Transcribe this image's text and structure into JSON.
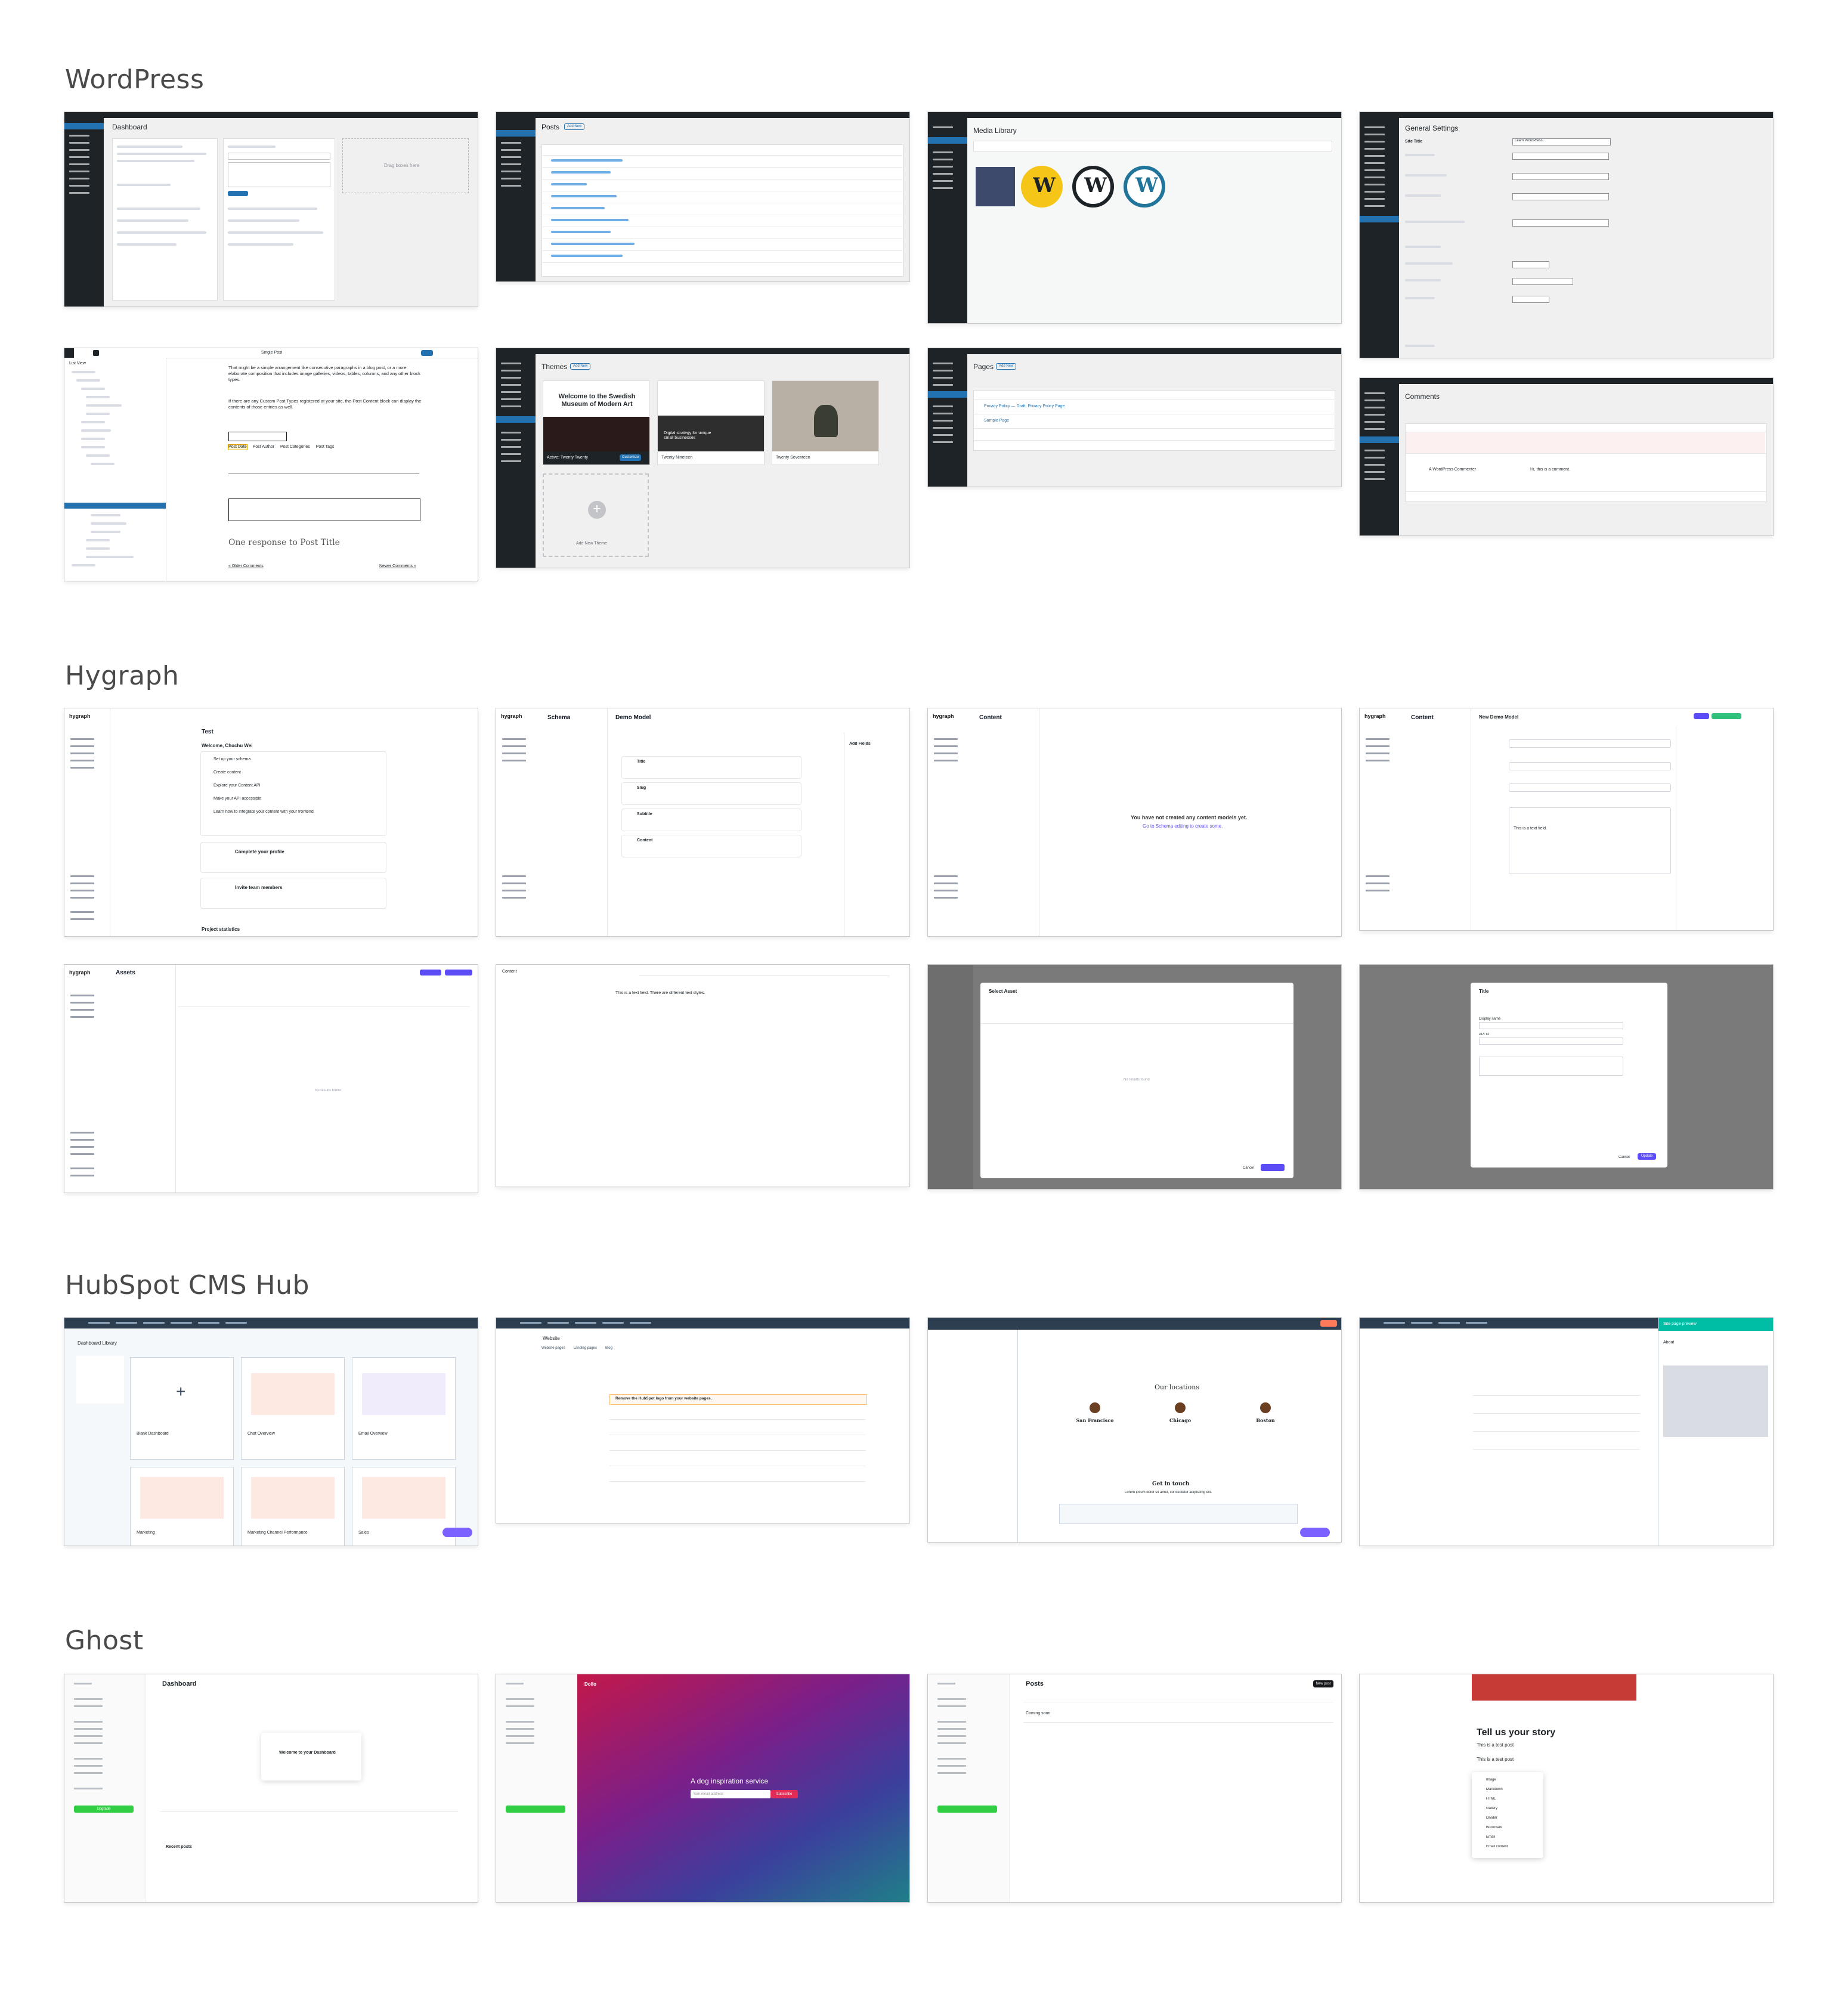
{
  "sections": {
    "wordpress": "WordPress",
    "hygraph": "Hygraph",
    "hubspot": "HubSpot CMS Hub",
    "ghost": "Ghost"
  },
  "wordpress": {
    "dashboard": {
      "title": "Dashboard",
      "drag_box": "Drag boxes here"
    },
    "posts": {
      "title": "Posts",
      "add_new": "Add New"
    },
    "media": {
      "title": "Media Library",
      "add_new": "Add New"
    },
    "settings": {
      "title": "General Settings",
      "site_title_label": "Site Title",
      "site_title_value": "Learn WordPress"
    },
    "editor": {
      "template": "Single Post",
      "list_view": "List View",
      "paragraph_1": "That might be a simple arrangement like consecutive paragraphs in a blog post, or a more elaborate composition that includes image galleries, videos, tables, columns, and any other block types.",
      "paragraph_2": "If there are any Custom Post Types registered at your site, the Post Content block can display the contents of those entries as well.",
      "meta_items": [
        "Post Date",
        "Post Author",
        "Post Categories",
        "Post Tags"
      ],
      "response_heading": "One response to Post Title",
      "older_comments": "« Older Comments",
      "newer_comments": "Newer Comments »",
      "selected_block": "Post Date"
    },
    "themes": {
      "title": "Themes",
      "add_new": "Add New",
      "museum_heading": "Welcome to the Swedish Museum of Modern Art",
      "active_label": "Active: Twenty Twenty",
      "customize": "Customize",
      "theme_2": "Twenty Nineteen",
      "theme_2_text": "Digital strategy for unique small businesses",
      "theme_3": "Twenty Seventeen",
      "add_theme": "Add New Theme"
    },
    "pages": {
      "title": "Pages",
      "add_new": "Add New",
      "rows": [
        "Privacy Policy — Draft, Privacy Policy Page",
        "Sample Page"
      ]
    },
    "comments": {
      "title": "Comments",
      "author": "A WordPress Commenter",
      "text": "Hi, this is a comment."
    }
  },
  "hygraph": {
    "logo": "hygraph",
    "getting_started": {
      "title": "Test",
      "welcome": "Welcome, Chuchu Wei",
      "steps": [
        "Set up your schema",
        "Create content",
        "Explore your Content API",
        "Make your API accessible",
        "Learn how to integrate your content with your frontend"
      ],
      "profile": "Complete your profile",
      "invite": "Invite team members",
      "stats": "Project statistics"
    },
    "schema": {
      "title": "Schema",
      "model": "Demo Model",
      "add_fields": "Add Fields",
      "fields": [
        "Title",
        "Slug",
        "Subtitle",
        "Content"
      ]
    },
    "content_empty": {
      "title": "Content",
      "empty": "You have not created any content models yet.",
      "link": "Go to Schema editing to create some."
    },
    "content_editor": {
      "title": "Content",
      "entry": "New Demo Model",
      "body": "This is a text field."
    },
    "assets": {
      "title": "Assets",
      "empty": "No results found"
    },
    "rich_text": {
      "title": "Content",
      "body": "This is a text field. There are different text styles."
    },
    "select_asset": {
      "title": "Select Asset",
      "empty": "No results found",
      "cancel": "Cancel"
    },
    "field_dialog": {
      "title": "Title",
      "display_name": "Display name",
      "api_id": "API ID",
      "cancel": "Cancel",
      "update": "Update"
    }
  },
  "hubspot": {
    "library": {
      "title": "Dashboard Library",
      "cards": [
        "Blank Dashboard",
        "Chat Overview",
        "Email Overview",
        "Marketing",
        "Marketing Channel Performance",
        "Sales"
      ]
    },
    "website": {
      "title": "Website",
      "tabs": [
        "Website pages",
        "Landing pages",
        "Blog"
      ],
      "banner": "Remove the HubSpot logo from your website pages."
    },
    "editor": {
      "locations": "Our locations",
      "cities": [
        "San Francisco",
        "Chicago",
        "Boston"
      ],
      "addresses": [
        "2 Hum Street, San Francisco, CA",
        "2700 Pepper Road, Chicago, IL",
        "123 Beverly Place, Boston, MA"
      ],
      "get_in_touch": "Get in touch",
      "subtext": "Lorem ipsum dolor sit amet, consectetur adipiscing elit."
    },
    "preview": {
      "title": "Site page preview",
      "about": "About"
    }
  },
  "ghost": {
    "dashboard": {
      "title": "Dashboard",
      "welcome": "Welcome to your Dashboard",
      "recent": "Recent posts",
      "upgrade": "Upgrade"
    },
    "site": {
      "brand": "Dollo",
      "hero": "A dog inspiration service",
      "subscribe": "Subscribe",
      "email_placeholder": "Your email address"
    },
    "posts": {
      "title": "Posts",
      "new_post": "New post",
      "item": "Coming soon"
    },
    "editor": {
      "title": "Tell us your story",
      "line_1": "This is a test post",
      "line_2": "This is a test post",
      "menu": [
        "Image",
        "Markdown",
        "HTML",
        "Gallery",
        "Divider",
        "Bookmark",
        "Email",
        "Email content"
      ]
    }
  }
}
